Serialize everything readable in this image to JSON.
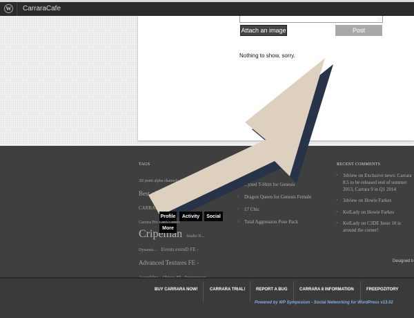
{
  "adminbar": {
    "wp_logo": "W",
    "site_name": "CarraraCafe"
  },
  "composer": {
    "resize_grip": ":::",
    "attach_label": "Attach an image",
    "post_label": "Post"
  },
  "feed": {
    "empty_text": "Nothing to show, sorry."
  },
  "footer": {
    "tags_heading": "TAGS",
    "tags": [
      {
        "text": "3D paint alpha channels Ar...",
        "size": "t-xs"
      },
      {
        "text": "Best of 2012",
        "size": "t-m"
      },
      {
        "text": "Blog C...",
        "size": "t-xs"
      },
      {
        "text": "CARRARA Carrara...",
        "size": "t-s"
      },
      {
        "text": "Carrara Pro CMS Center",
        "size": "t-xs"
      },
      {
        "text": "Cripeman",
        "size": "t-xl"
      },
      {
        "text": "Studio D...",
        "size": "t-xs"
      },
      {
        "text": "Dynamic...",
        "size": "t-xs"
      },
      {
        "text": "Events extruD FE -",
        "size": "t-s"
      },
      {
        "text": "Advanced Textures FE -",
        "size": "t-m"
      },
      {
        "text": "Assembling",
        "size": "t-xs"
      },
      {
        "text": "Objects FE - Environment",
        "size": "t-xs"
      }
    ],
    "middle_items": [
      "...yzed T-Shirt for Genesis",
      "Dragon Queen for Genesis Female",
      "17 Chic",
      "Total Aggression Pose Pack"
    ],
    "recent_heading": "RECENT COMMENTS",
    "recent_comments": [
      "3dview on Exclusive news: Carrara 8.5 to be released end of summer 2013, Carrara 9 in Q1 2014",
      "3dview on Howie Farkes",
      "KelLady on Howie Farkes",
      "KelLady on C3DE Issue 10 is around the corner!"
    ],
    "designed_by": "Designed b"
  },
  "profile_menu": {
    "profile": "Profile",
    "activity": "Activity",
    "social": "Social",
    "more": "More"
  },
  "nav": {
    "items": [
      "BUY CARRARA NOW!",
      "CARRARA TRIAL!",
      "REPORT A BUG",
      "CARRARA 8 INFORMATION",
      "FREEPOZITORY"
    ],
    "powered_by": "Powered by WP Symposium - Social Networking for WordPress v13.02"
  },
  "colors": {
    "arrow_fill": "#ddd0bf",
    "arrow_shadow": "#263349",
    "footer_bg": "#3f3f3f",
    "link_blue": "#7fb0e0"
  }
}
